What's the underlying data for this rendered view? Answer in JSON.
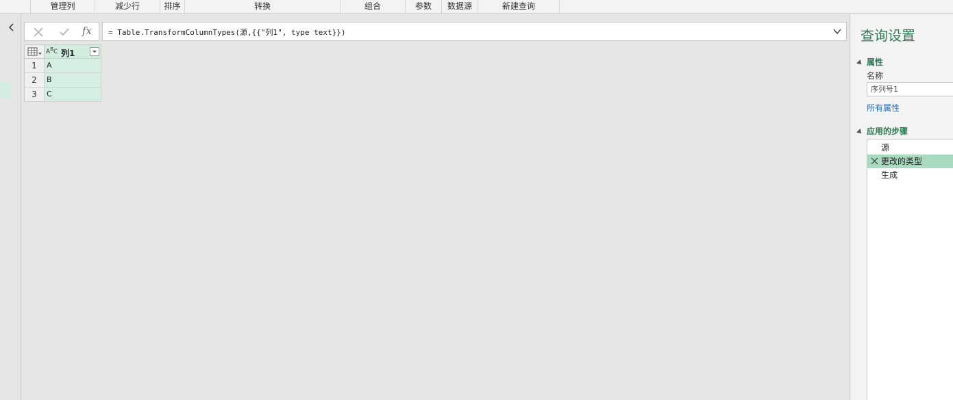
{
  "ribbon": {
    "groups": [
      "管理列",
      "减少行",
      "排序",
      "转换",
      "组合",
      "参数",
      "数据源",
      "新建查询"
    ]
  },
  "formula_bar": {
    "fx_label": "fx",
    "formula": "= Table.TransformColumnTypes(源,{{\"列1\", type text}})"
  },
  "grid": {
    "column_type": "ABC",
    "column_name": "列1",
    "rows": [
      {
        "num": "1",
        "value": "A"
      },
      {
        "num": "2",
        "value": "B"
      },
      {
        "num": "3",
        "value": "C"
      }
    ]
  },
  "query_settings": {
    "title": "查询设置",
    "properties_header": "属性",
    "name_label": "名称",
    "name_value": "序列号1",
    "all_properties_link": "所有属性",
    "steps_header": "应用的步骤",
    "steps": [
      {
        "label": "源",
        "active": false
      },
      {
        "label": "更改的类型",
        "active": true
      },
      {
        "label": "生成",
        "active": false
      }
    ]
  },
  "colors": {
    "accent": "#2f7a55",
    "selected_step": "#a8dbbf",
    "column_fill": "#d5f0e2"
  },
  "icons": [
    "chevron-left-icon",
    "cancel-x-icon",
    "check-icon",
    "expand-chevron-icon",
    "table-menu-icon",
    "abc-type-icon",
    "filter-dropdown-icon",
    "delete-step-icon"
  ]
}
